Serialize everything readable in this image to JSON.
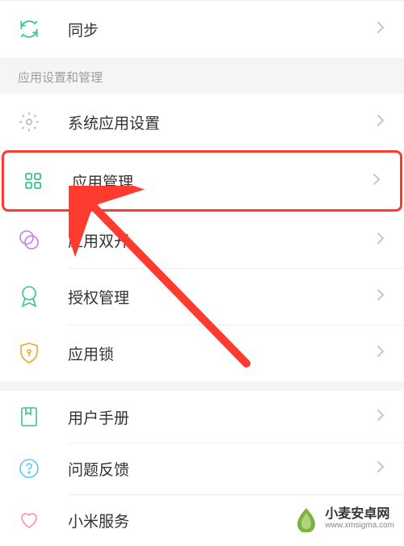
{
  "section1": {
    "sync": "同步"
  },
  "header": "应用设置和管理",
  "section2": {
    "systemApps": "系统应用设置",
    "appManage": "应用管理",
    "dualApps": "应用双开",
    "permissions": "授权管理",
    "appLock": "应用锁"
  },
  "section3": {
    "manual": "用户手册",
    "feedback": "问题反馈",
    "xiaomiService": "小米服务"
  },
  "watermark": {
    "main": "小麦安卓网",
    "sub": "www.xmsigma.com"
  },
  "colors": {
    "highlight": "#ff3b30",
    "iconGreen": "#3bc489",
    "iconOrange": "#f5a623",
    "iconPurple": "#c77de8",
    "iconBlue": "#5ac8fa"
  }
}
